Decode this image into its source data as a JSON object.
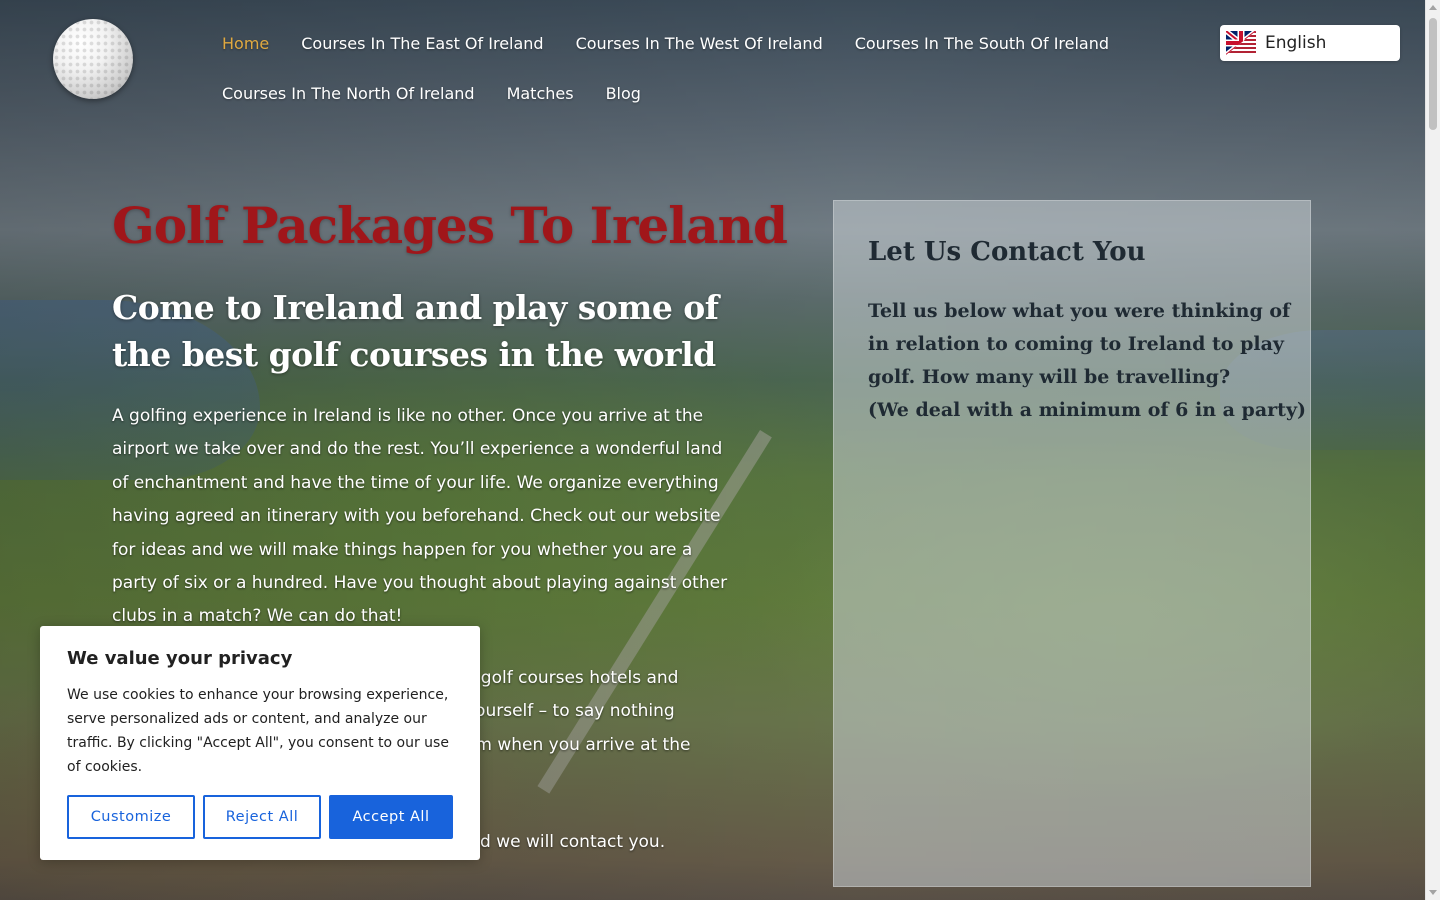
{
  "nav": {
    "items": [
      {
        "label": "Home",
        "active": true
      },
      {
        "label": "Courses In The East Of Ireland"
      },
      {
        "label": "Courses In The West Of Ireland"
      },
      {
        "label": "Courses In The South Of Ireland"
      },
      {
        "label": "Courses In The North Of Ireland"
      },
      {
        "label": "Matches"
      },
      {
        "label": "Blog"
      }
    ],
    "active_color": "#e0a940"
  },
  "language": {
    "label": "English",
    "flag_icon": "uk-us-flag-icon"
  },
  "logo": {
    "icon": "golf-ball-icon"
  },
  "hero": {
    "title": "Golf Packages To Ireland",
    "title_color": "#a0161a",
    "subtitle": "Come to Ireland and play some of the best golf courses in the world",
    "paragraph1": "A golfing experience in Ireland is like no other. Once you arrive at the airport we take over and do the rest. You’ll experience a wonderful land of enchantment and have the time of your life. We organize everything having agreed an itinerary with you beforehand. Check out our website for ideas and we will make things happen for you whether you are a party of six or a hundred. Have you thought about playing against other clubs in a match? We can do that!",
    "paragraph2_visible": "o golf courses hotels and\nyourself – to say nothing\nom when you arrive at the",
    "paragraph3_visible": "d we will contact you."
  },
  "contact": {
    "title": "Let Us Contact You",
    "body_lines": [
      "Tell us below what you were thinking of",
      "in relation to coming to Ireland to play",
      "golf. How many will be travelling?",
      "(We deal with a minimum of 6 in a party)"
    ]
  },
  "cookie": {
    "title": "We value your privacy",
    "text": "We use cookies to enhance your browsing experience, serve personalized ads or content, and analyze our traffic. By clicking \"Accept All\", you consent to our use of cookies.",
    "customize_label": "Customize",
    "reject_label": "Reject All",
    "accept_label": "Accept All",
    "accent_color": "#1863dc"
  }
}
